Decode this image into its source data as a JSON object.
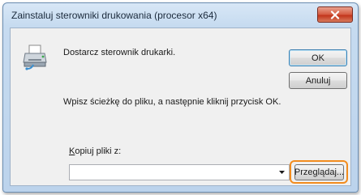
{
  "window": {
    "title": "Zainstaluj sterowniki drukowania (procesor x64)"
  },
  "dialog": {
    "message": "Dostarcz sterownik drukarki.",
    "instruction": "Wpisz ścieżkę do pliku, a następnie kliknij przycisk OK.",
    "copy_label_first": "K",
    "copy_label_rest": "opiuj pliki z:",
    "path_value": "",
    "ok_label": "OK",
    "cancel_label": "Anuluj",
    "browse_first": "Przeglądaj...",
    "browse_accel": "g",
    "browse_accel_prefix": "Prze",
    "browse_accel_suffix": "lądaj..."
  },
  "colors": {
    "highlight": "#f28c1e",
    "close_button": "#c9432a"
  },
  "icons": [
    "printer-icon",
    "close-icon",
    "chevron-down-icon"
  ]
}
